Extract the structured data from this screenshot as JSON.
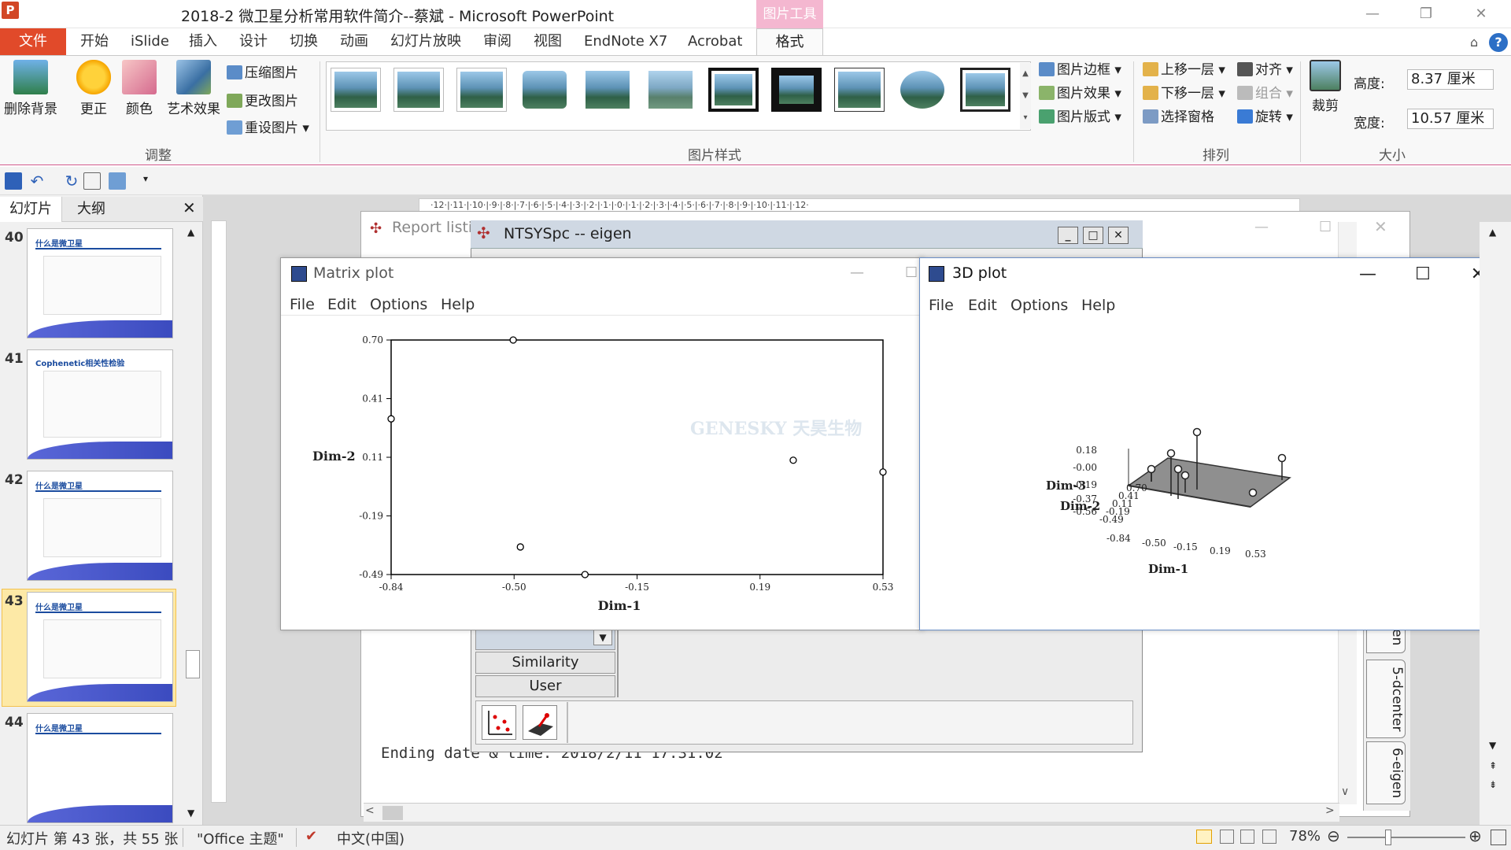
{
  "window": {
    "title": "2018-2 微卫星分析常用软件简介--蔡斌 - Microsoft PowerPoint",
    "tool_header": "图片工具"
  },
  "ribbon": {
    "file_tab": "文件",
    "tabs": [
      "开始",
      "iSlide",
      "插入",
      "设计",
      "切换",
      "动画",
      "幻灯片放映",
      "审阅",
      "视图",
      "EndNote X7",
      "Acrobat"
    ],
    "format_tab": "格式",
    "adjust": {
      "remove_bg": "删除背景",
      "corrections": "更正",
      "color": "颜色",
      "artistic": "艺术效果",
      "compress": "压缩图片",
      "change": "更改图片",
      "reset": "重设图片",
      "group_label": "调整"
    },
    "styles": {
      "group_label": "图片样式",
      "border": "图片边框",
      "effects": "图片效果",
      "layout": "图片版式"
    },
    "arrange": {
      "group_label": "排列",
      "bring_forward": "上移一层",
      "send_backward": "下移一层",
      "selection_pane": "选择窗格",
      "align": "对齐",
      "group": "组合",
      "rotate": "旋转"
    },
    "size": {
      "group_label": "大小",
      "crop": "裁剪",
      "height_label": "高度:",
      "height_value": "8.37 厘米",
      "width_label": "宽度:",
      "width_value": "10.57 厘米"
    }
  },
  "left_panel": {
    "tab_slides": "幻灯片",
    "tab_outline": "大纲",
    "close": "✕",
    "slides": [
      {
        "num": "40",
        "title": "什么是微卫星"
      },
      {
        "num": "41",
        "title": "Cophenetic相关性检验"
      },
      {
        "num": "42",
        "title": "什么是微卫星"
      },
      {
        "num": "43",
        "title": "什么是微卫星"
      },
      {
        "num": "44",
        "title": "什么是微卫星"
      }
    ]
  },
  "report": {
    "title": "Report listi",
    "ending_line": "Ending date & time: 2018/2/11 17:31:02"
  },
  "ntsys": {
    "title": "NTSYSpc  -- eigen",
    "list_similarity": "Similarity",
    "list_user": "User",
    "tabs": [
      "5-dcenter",
      "6-eigen",
      "en"
    ]
  },
  "matrix_plot": {
    "title": "Matrix plot",
    "menu": [
      "File",
      "Edit",
      "Options",
      "Help"
    ],
    "watermark": "GENESKY 天昊生物"
  },
  "plot_3d": {
    "title": "3D plot",
    "menu": [
      "File",
      "Edit",
      "Options",
      "Help"
    ]
  },
  "chart_data": [
    {
      "type": "scatter",
      "title": "",
      "xlabel": "Dim-1",
      "ylabel": "Dim-2",
      "xlim": [
        -0.84,
        0.53
      ],
      "ylim": [
        -0.49,
        0.7
      ],
      "x_ticks": [
        "-0.84",
        "-0.50",
        "-0.15",
        "0.19",
        "0.53"
      ],
      "y_ticks": [
        "0.70",
        "0.41",
        "0.11",
        "-0.19",
        "-0.49"
      ],
      "points": [
        {
          "x": -0.5,
          "y": 0.7
        },
        {
          "x": -0.84,
          "y": 0.3
        },
        {
          "x": 0.28,
          "y": 0.09
        },
        {
          "x": 0.53,
          "y": 0.03
        },
        {
          "x": -0.48,
          "y": -0.35
        },
        {
          "x": -0.3,
          "y": -0.49
        }
      ]
    },
    {
      "type": "scatter",
      "title": "",
      "xlabel": "Dim-1",
      "ylabel": "Dim-2",
      "zlabel": "Dim-3",
      "x_ticks": [
        "-0.84",
        "-0.50",
        "-0.15",
        "0.19",
        "0.53"
      ],
      "y_ticks": [
        "0.70",
        "0.41",
        "0.11",
        "-0.19",
        "-0.49"
      ],
      "z_ticks": [
        "0.18",
        "-0.00",
        "-0.19",
        "-0.37",
        "-0.56"
      ]
    }
  ],
  "status": {
    "slide_info": "幻灯片 第 43 张，共 55 张",
    "theme": "\"Office 主题\"",
    "language": "中文(中国)",
    "zoom": "78%"
  },
  "colors": {
    "file_tab": "#e14a2a",
    "picture_tool": "#f4b7d0",
    "selected_slide": "#fde9a6"
  }
}
